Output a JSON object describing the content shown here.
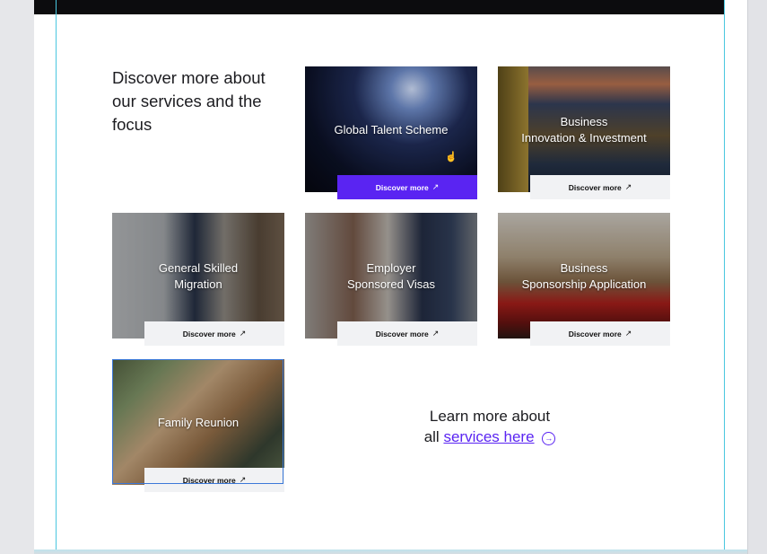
{
  "intro": {
    "heading": "Discover more about our services and the focus"
  },
  "cards": [
    {
      "title": "Global Talent Scheme",
      "button": "Discover more",
      "button_style": "primary"
    },
    {
      "title": "Business\nInnovation & Investment",
      "button": "Discover more",
      "button_style": "light"
    },
    {
      "title": "General Skilled\nMigration",
      "button": "Discover more",
      "button_style": "light"
    },
    {
      "title": "Employer\nSponsored Visas",
      "button": "Discover more",
      "button_style": "light"
    },
    {
      "title": "Business\nSponsorship Application",
      "button": "Discover more",
      "button_style": "light"
    },
    {
      "title": "Family Reunion",
      "button": "Discover more",
      "button_style": "light"
    }
  ],
  "learn_more": {
    "prefix_line1": "Learn more about",
    "prefix_line2": "all",
    "link_text": "services here"
  },
  "colors": {
    "accent": "#5a24f2",
    "button_light": "#f1f2f4",
    "top_bar": "#0c0c0e",
    "guides": "#49c7df"
  },
  "icons": {
    "button_arrow": "arrow-up-right-icon",
    "link_arrow": "circle-arrow-right-icon"
  }
}
